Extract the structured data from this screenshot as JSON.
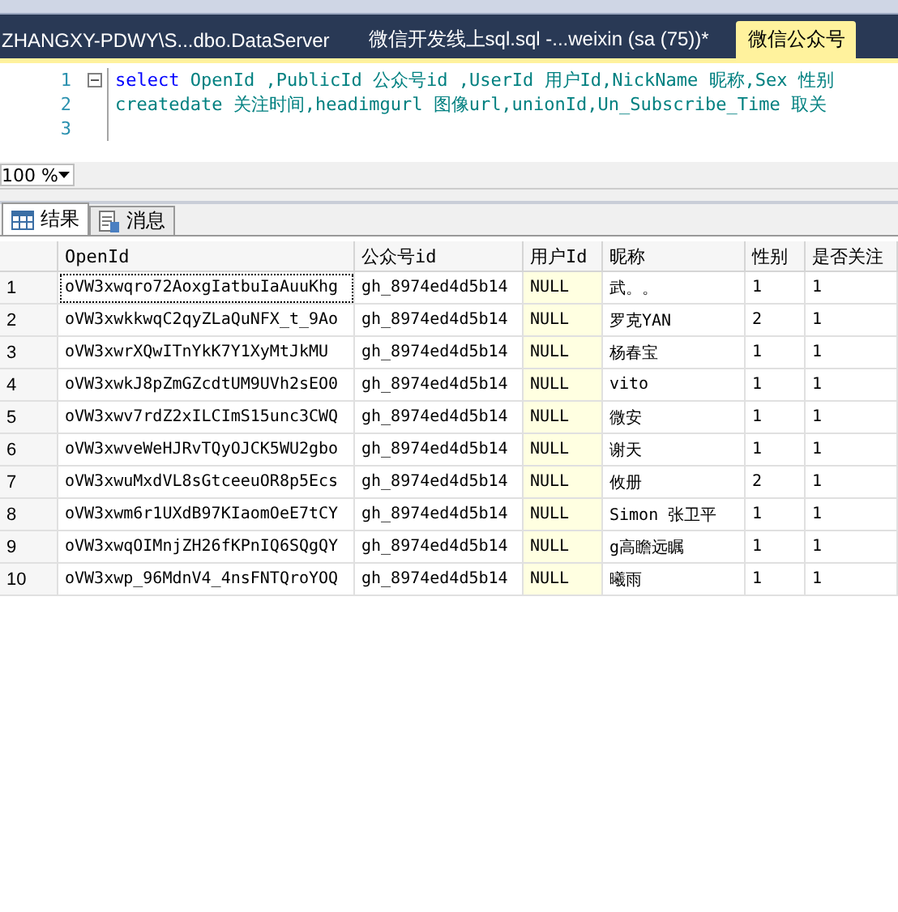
{
  "doc_tabs": [
    {
      "label": "ZHANGXY-PDWY\\S...dbo.DataServer",
      "selected": false
    },
    {
      "label": "微信开发线上sql.sql -...weixin (sa (75))*",
      "selected": false
    },
    {
      "label": "微信公众号",
      "selected": true
    }
  ],
  "editor": {
    "lines": [
      {
        "number": "1",
        "collapsible": true,
        "segments": [
          {
            "kind": "keyword",
            "text": "select"
          },
          {
            "kind": "identifier",
            "text": " OpenId ,PublicId 公众号id ,UserId 用户Id,NickName 昵称,Sex 性别"
          }
        ]
      },
      {
        "number": "2",
        "collapsible": false,
        "segments": [
          {
            "kind": "identifier",
            "text": "createdate 关注时间,headimgurl 图像url,unionId,Un_Subscribe_Time 取关"
          }
        ]
      },
      {
        "number": "3",
        "collapsible": false
      }
    ]
  },
  "zoom": "100 %",
  "result_tabs": [
    {
      "label": "结果",
      "selected": true
    },
    {
      "label": "消息",
      "selected": false
    }
  ],
  "table": {
    "columns": [
      "OpenId",
      "公众号id",
      "用户Id",
      "昵称",
      "性别",
      "是否关注"
    ],
    "rows": [
      {
        "number": "1",
        "focused": true,
        "cells": [
          "oVW3xwqro72AoxgIatbuIaAuuKhg",
          "gh_8974ed4d5b14",
          "NULL",
          "武。。",
          "1",
          "1"
        ]
      },
      {
        "number": "2",
        "focused": false,
        "cells": [
          "oVW3xwkkwqC2qyZLaQuNFX_t_9Ao",
          "gh_8974ed4d5b14",
          "NULL",
          "罗克YAN",
          "2",
          "1"
        ]
      },
      {
        "number": "3",
        "focused": false,
        "cells": [
          "oVW3xwrXQwITnYkK7Y1XyMtJkMU",
          "gh_8974ed4d5b14",
          "NULL",
          "杨春宝",
          "1",
          "1"
        ]
      },
      {
        "number": "4",
        "focused": false,
        "cells": [
          "oVW3xwkJ8pZmGZcdtUM9UVh2sEO0",
          "gh_8974ed4d5b14",
          "NULL",
          "vito",
          "1",
          "1"
        ]
      },
      {
        "number": "5",
        "focused": false,
        "cells": [
          "oVW3xwv7rdZ2xILCImS15unc3CWQ",
          "gh_8974ed4d5b14",
          "NULL",
          "微安",
          "1",
          "1"
        ]
      },
      {
        "number": "6",
        "focused": false,
        "cells": [
          "oVW3xwveWeHJRvTQyOJCK5WU2gbo",
          "gh_8974ed4d5b14",
          "NULL",
          "谢天",
          "1",
          "1"
        ]
      },
      {
        "number": "7",
        "focused": false,
        "cells": [
          "oVW3xwuMxdVL8sGtceeuOR8p5Ecs",
          "gh_8974ed4d5b14",
          "NULL",
          "攸册",
          "2",
          "1"
        ]
      },
      {
        "number": "8",
        "focused": false,
        "cells": [
          "oVW3xwm6r1UXdB97KIaomOeE7tCY",
          "gh_8974ed4d5b14",
          "NULL",
          "Simon 张卫平",
          "1",
          "1"
        ]
      },
      {
        "number": "9",
        "focused": false,
        "cells": [
          "oVW3xwqOIMnjZH26fKPnIQ6SQgQY",
          "gh_8974ed4d5b14",
          "NULL",
          "g高瞻远瞩",
          "1",
          "1"
        ]
      },
      {
        "number": "10",
        "focused": false,
        "cells": [
          "oVW3xwp_96MdnV4_4nsFNTQroYOQ",
          "gh_8974ed4d5b14",
          "NULL",
          "曦雨",
          "1",
          "1"
        ]
      }
    ]
  }
}
